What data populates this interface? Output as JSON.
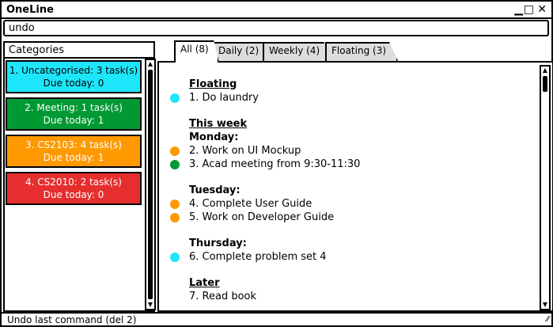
{
  "window": {
    "title": "OneLine",
    "controls": {
      "minimize": "▁",
      "maximize": "□",
      "close": "✕"
    }
  },
  "command": {
    "value": "undo"
  },
  "categories": {
    "header": "Categories",
    "items": [
      {
        "line1": "1. Uncategorised: 3 task(s)",
        "line2": "Due today: 0",
        "color": "#1ee6fa"
      },
      {
        "line1": "2. Meeting: 1 task(s)",
        "line2": "Due today: 1",
        "color": "#009933"
      },
      {
        "line1": "3. CS2103: 4 task(s)",
        "line2": "Due today: 1",
        "color": "#ff9900"
      },
      {
        "line1": "4. CS2010: 2 task(s)",
        "line2": "Due today: 0",
        "color": "#e62e2e"
      }
    ]
  },
  "tabs": [
    {
      "label": "All (8)",
      "active": true
    },
    {
      "label": "Daily (2)",
      "active": false
    },
    {
      "label": "Weekly (4)",
      "active": false
    },
    {
      "label": "Floating (3)",
      "active": false
    }
  ],
  "tasks": {
    "floating": {
      "title": "Floating",
      "items": [
        {
          "text": "1. Do laundry",
          "color": "#1ee6fa"
        }
      ]
    },
    "this_week": {
      "title": "This week",
      "days": [
        {
          "name": "Monday:",
          "items": [
            {
              "text": "2. Work on UI Mockup",
              "color": "#ff9900"
            },
            {
              "text": "3. Acad meeting from 9:30-11:30",
              "color": "#009933"
            }
          ]
        },
        {
          "name": "Tuesday:",
          "items": [
            {
              "text": "4. Complete User Guide",
              "color": "#ff9900"
            },
            {
              "text": "5. Work on Developer Guide",
              "color": "#ff9900"
            }
          ]
        },
        {
          "name": "Thursday:",
          "items": [
            {
              "text": "6. Complete problem set 4",
              "color": "#1ee6fa"
            }
          ]
        }
      ]
    },
    "later": {
      "title": "Later",
      "items": [
        {
          "text": "7. Read book",
          "color": "#ffffff"
        }
      ]
    }
  },
  "status": {
    "text": "Undo last command (del 2)",
    "grip": "⁄⁄"
  }
}
